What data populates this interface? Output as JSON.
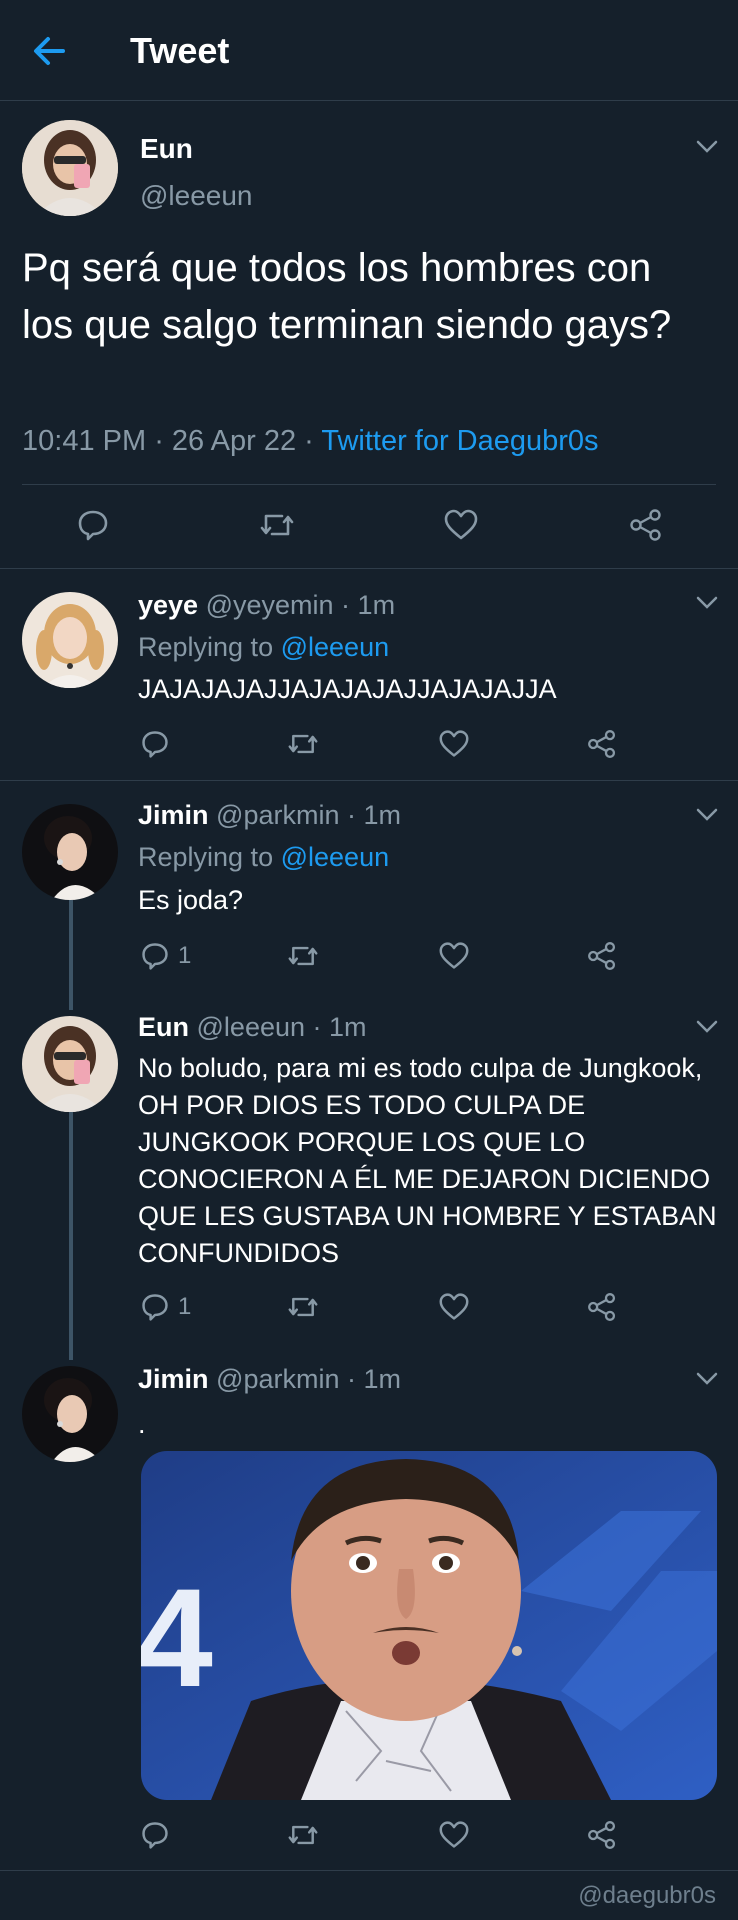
{
  "header": {
    "title": "Tweet"
  },
  "main": {
    "name": "Eun",
    "handle": "@leeeun",
    "text": "Pq será que todos los hombres con los que salgo terminan siendo gays?",
    "time": "10:41 PM",
    "date": "26 Apr 22",
    "source": "Twitter for Daegubr0s"
  },
  "replies": [
    {
      "name": "yeye",
      "handle": "@yeyemin",
      "time": "1m",
      "replying_label": "Replying to",
      "replying_to": "@leeeun",
      "text": "JAJAJAJAJJAJAJAJAJJAJAJAJJA",
      "reply_count": ""
    },
    {
      "name": "Jimin",
      "handle": "@parkmin",
      "time": "1m",
      "replying_label": "Replying to",
      "replying_to": "@leeeun",
      "text": "Es joda?",
      "reply_count": "1"
    },
    {
      "name": "Eun",
      "handle": "@leeeun",
      "time": "1m",
      "text": "No boludo, para mi es todo culpa de Jungkook, OH POR DIOS ES TODO CULPA DE JUNGKOOK PORQUE LOS QUE LO CONOCIERON A ÉL ME DEJARON DICIENDO QUE LES GUSTABA UN HOMBRE Y ESTABAN CONFUNDIDOS",
      "reply_count": "1"
    },
    {
      "name": "Jimin",
      "handle": "@parkmin",
      "time": "1m",
      "text": ".",
      "media_caption": "4"
    }
  ],
  "separator": " · ",
  "watermark": "@daegubr0s",
  "colors": {
    "background": "#15202b",
    "accent": "#1d9bf0",
    "muted": "#8899a6",
    "divider": "#2f3d4a"
  },
  "icons": [
    "back-arrow-icon",
    "chevron-down-icon",
    "reply-icon",
    "retweet-icon",
    "like-icon",
    "share-icon"
  ]
}
